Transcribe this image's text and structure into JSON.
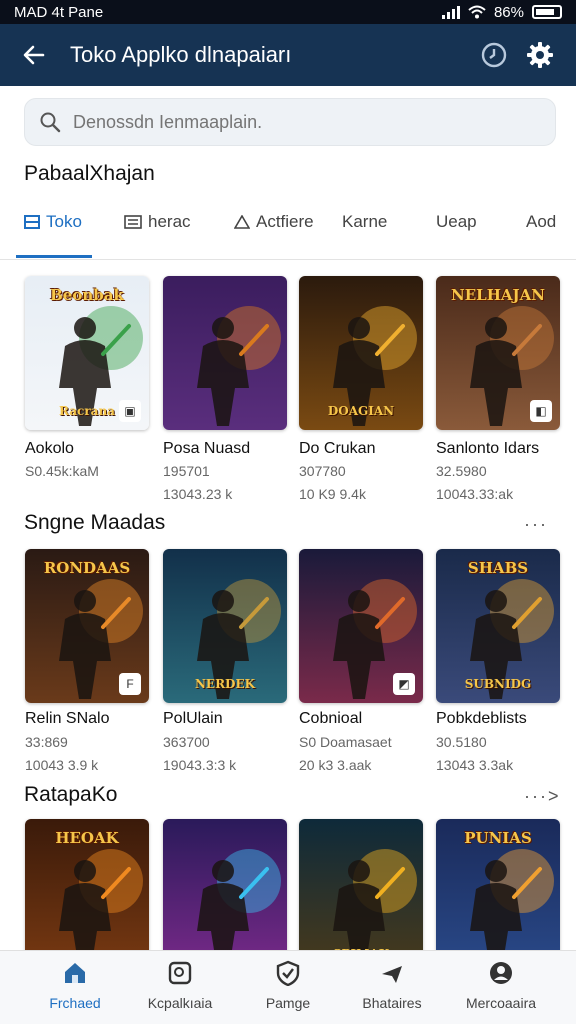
{
  "status_bar": {
    "left_text": "MAD 4t Pane",
    "battery_text": "86%"
  },
  "app_bar": {
    "title": "Toko Applko dlnapaiarı",
    "back_icon": "back-arrow-icon",
    "history_icon": "clock-icon",
    "settings_icon": "gear-icon",
    "color": "#163353"
  },
  "search": {
    "placeholder": "Denossdn Ienmaaplain."
  },
  "section1": {
    "title": "PabaalXhajan"
  },
  "tabs": [
    {
      "label": "Toko",
      "icon": "store-icon",
      "active": true
    },
    {
      "label": "herac",
      "icon": "list-icon",
      "active": false
    },
    {
      "label": "Actfiere",
      "icon": "triangle-icon",
      "active": false
    },
    {
      "label": "Karne",
      "active": false
    },
    {
      "label": "Ueap",
      "active": false
    },
    {
      "label": "Aod",
      "active": false
    }
  ],
  "row1": [
    {
      "name": "Aokolo",
      "line1": "S0.45k:kaM",
      "line2": "",
      "cover_title": "Beonbak",
      "cover_sub": "Racrana",
      "badge": "▣",
      "colors": [
        "#e7eef5",
        "#f4f6f9",
        "#3aa14a"
      ]
    },
    {
      "name": "Posa Nuasd",
      "line1": "195701",
      "line2": "13043.23 k",
      "colors": [
        "#3b1d5e",
        "#5a2e7d",
        "#d97a1e"
      ]
    },
    {
      "name": "Do Crukan",
      "line1": "307780",
      "line2": "10 K9 9.4k",
      "cover_sub": "DOAGIAN",
      "colors": [
        "#2b1a0d",
        "#7a4a12",
        "#f0b030"
      ]
    },
    {
      "name": "Sanlonto Idars",
      "line1": "32.5980",
      "line2": "10043.33:ak",
      "cover_title": "NELHAJAN",
      "badge": "◧",
      "colors": [
        "#4a2a1a",
        "#8a5a3a",
        "#c77a3a"
      ]
    }
  ],
  "section2": {
    "title": "Sngne Maadas",
    "more": "···"
  },
  "row2": [
    {
      "name": "Relin SNalo",
      "line1": "33:869",
      "line2": "10043 3.9 k",
      "cover_title": "RONDAAS",
      "badge": "F",
      "colors": [
        "#2a1a14",
        "#6a3a1a",
        "#e88a28"
      ]
    },
    {
      "name": "PolUlain",
      "line1": "363700",
      "line2": "19043.3:3 k",
      "cover_sub": "NERDEK",
      "colors": [
        "#12304a",
        "#2a6a7a",
        "#c69a3a"
      ]
    },
    {
      "name": "Cobnioal",
      "line1": "S0 Doamasaet",
      "line2": "20 k3 3.aak",
      "badge": "◩",
      "colors": [
        "#1a1a3a",
        "#7a2a4a",
        "#e06a2a"
      ]
    },
    {
      "name": "Pobkdeblists",
      "line1": "30.5180",
      "line2": "13043 3.3ak",
      "cover_title": "SHABS",
      "cover_sub": "SUBNIDG",
      "colors": [
        "#1a2a4a",
        "#3a4a7a",
        "#e0a030"
      ]
    }
  ],
  "section3": {
    "title": "RatapaKo",
    "more": "···>"
  },
  "row3": [
    {
      "cover_title": "HEOAK",
      "colors": [
        "#3a1a0a",
        "#7a3a12",
        "#f08a20"
      ]
    },
    {
      "colors": [
        "#2a1a5a",
        "#7a2a8a",
        "#3ac0f0"
      ]
    },
    {
      "cover_sub": "SPIMAK",
      "colors": [
        "#0e2a3a",
        "#4a3a1a",
        "#f0b020"
      ]
    },
    {
      "cover_title": "PUNIAS",
      "colors": [
        "#1a2a5a",
        "#2a4a8a",
        "#f0a030"
      ]
    }
  ],
  "bottom_nav": [
    {
      "label": "Frchaed",
      "icon": "home-icon",
      "active": true
    },
    {
      "label": "Kcpalkıaia",
      "icon": "games-icon",
      "active": false
    },
    {
      "label": "Pamge",
      "icon": "shield-icon",
      "active": false
    },
    {
      "label": "Bhataires",
      "icon": "plane-icon",
      "active": false
    },
    {
      "label": "Mercoaaira",
      "icon": "account-icon",
      "active": false
    }
  ],
  "colors": {
    "accent": "#1e6fc2",
    "app_bar": "#163353"
  }
}
